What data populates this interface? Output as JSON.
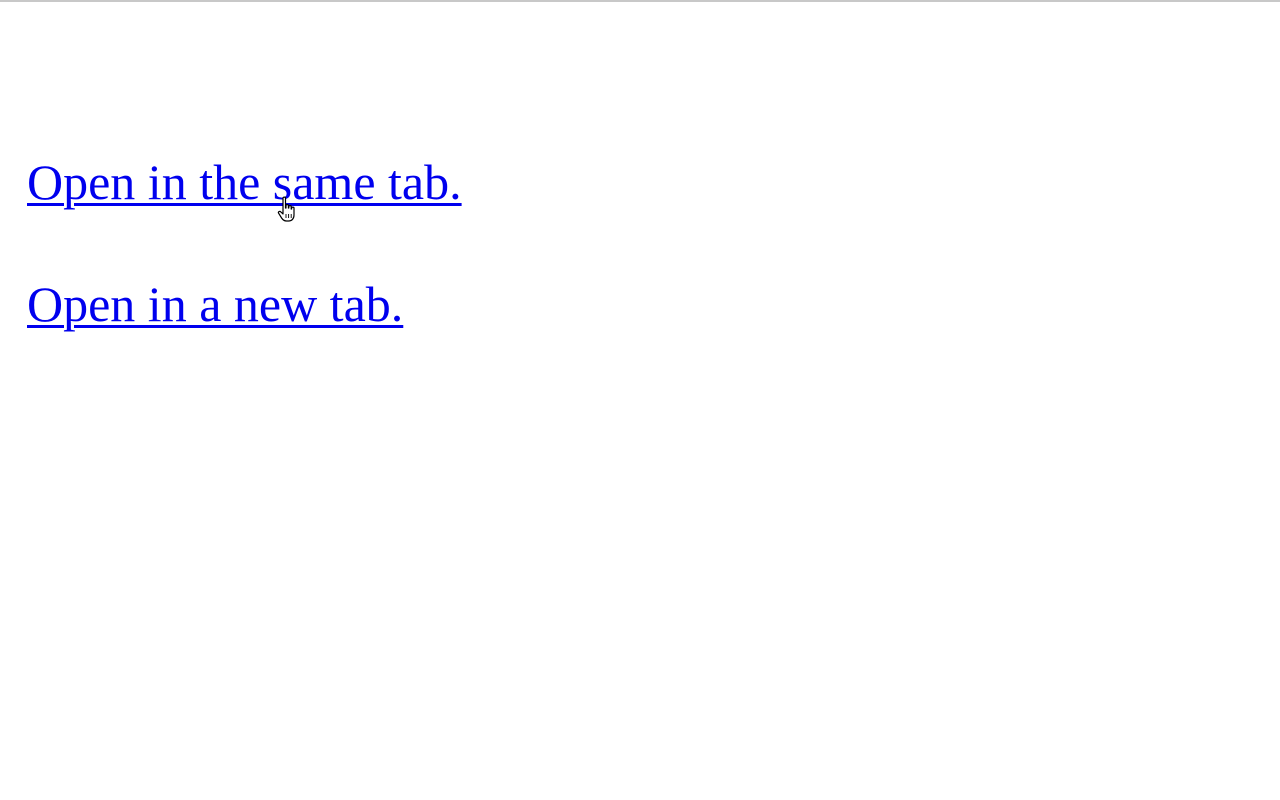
{
  "links": {
    "same_tab_label": "Open in the same tab.",
    "new_tab_label": "Open in a new tab."
  },
  "colors": {
    "link": "#0000ee",
    "background": "#ffffff",
    "top_border": "#c8c8c8"
  },
  "icons": {
    "cursor": "hand-pointer-cursor-icon"
  }
}
